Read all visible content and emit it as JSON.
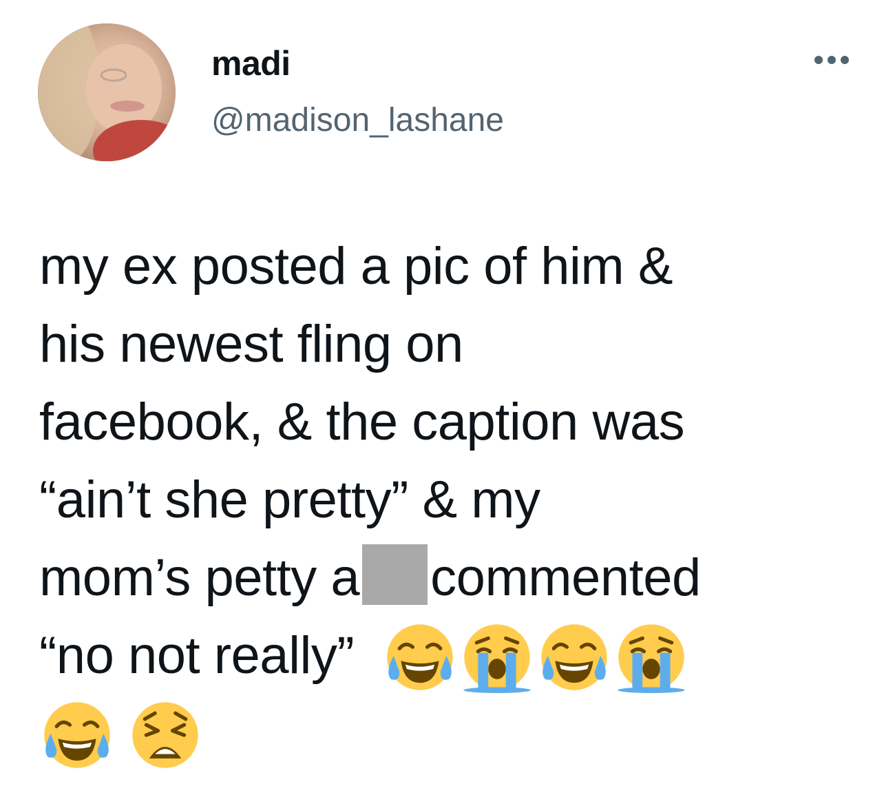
{
  "user": {
    "display_name": "madi",
    "handle": "@madison_lashane",
    "avatar_icon": "profile-photo"
  },
  "menu": {
    "more_icon": "more-horizontal-icon"
  },
  "tweet": {
    "line1": "my ex posted a pic of him &",
    "line2": "his newest fling on",
    "line3": "facebook, & the caption was",
    "line4": "“ain’t she pretty” & my",
    "line5_before": "mom’s petty a",
    "line5_after": "commented",
    "line6": "“no not really”",
    "emoji_row_1": [
      "face-with-tears-of-joy-icon",
      "loudly-crying-face-icon",
      "face-with-tears-of-joy-icon",
      "loudly-crying-face-icon"
    ],
    "emoji_row_2": [
      "face-with-tears-of-joy-icon",
      "weary-face-icon"
    ]
  },
  "colors": {
    "text": "#0f1419",
    "secondary": "#536471",
    "redaction": "#a9a9a9",
    "emoji_yellow": "#ffcc4d",
    "emoji_tear": "#5dadec"
  }
}
